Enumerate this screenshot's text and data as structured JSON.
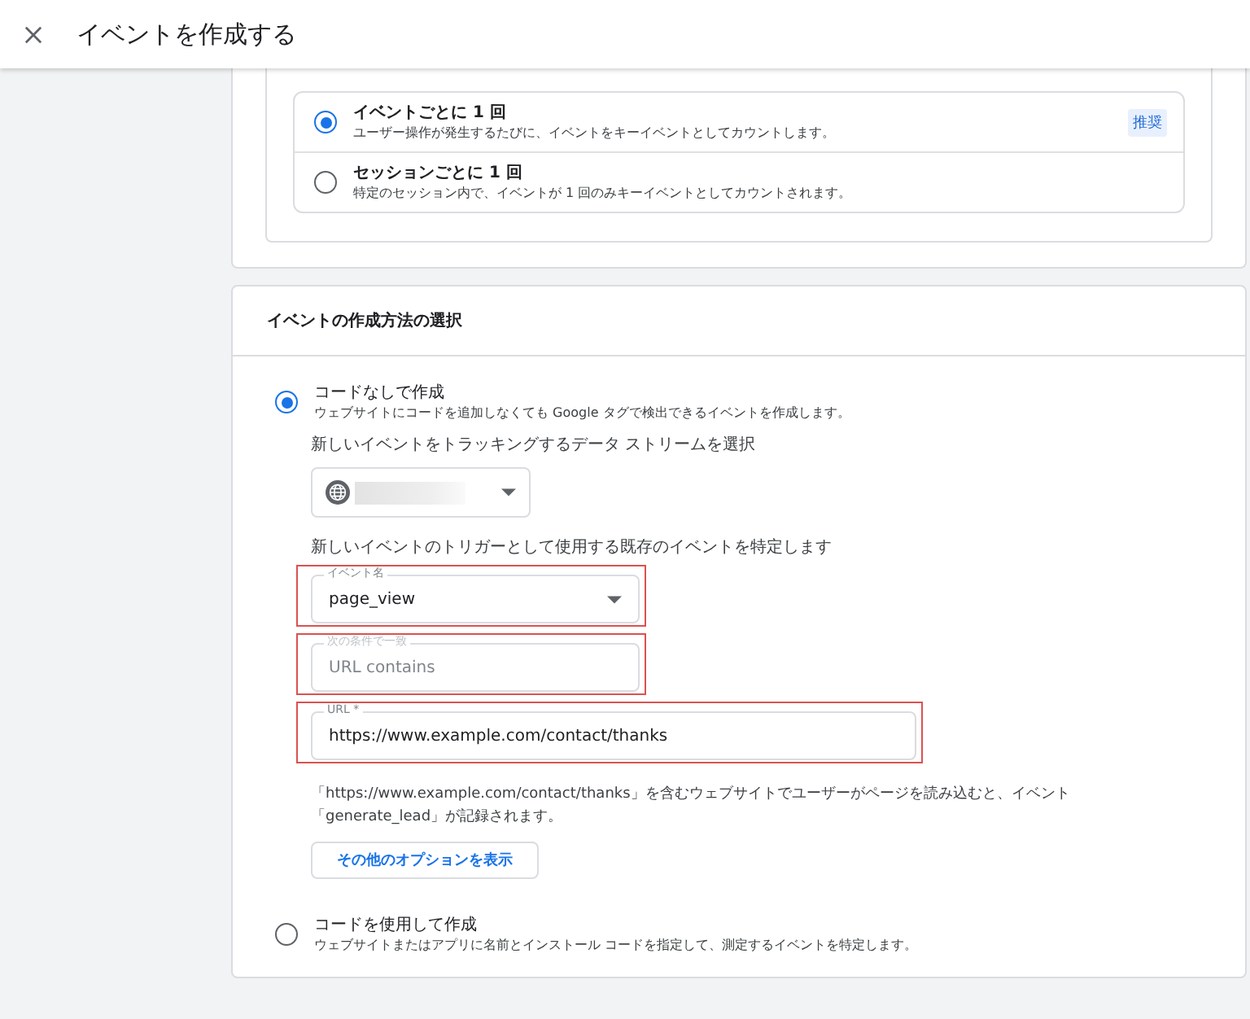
{
  "header": {
    "title": "イベントを作成する"
  },
  "count_method": {
    "options": [
      {
        "title": "イベントごとに 1 回",
        "description": "ユーザー操作が発生するたびに、イベントをキーイベントとしてカウントします。",
        "badge": "推奨",
        "selected": true
      },
      {
        "title": "セッションごとに 1 回",
        "description": "特定のセッション内で、イベントが 1 回のみキーイベントとしてカウントされます。",
        "selected": false
      }
    ]
  },
  "creation": {
    "heading": "イベントの作成方法の選択",
    "options": [
      {
        "kind": "no_code",
        "title": "コードなしで作成",
        "description": "ウェブサイトにコードを追加しなくても Google タグで検出できるイベントを作成します。",
        "selected": true
      },
      {
        "kind": "code",
        "title": "コードを使用して作成",
        "description": "ウェブサイトまたはアプリに名前とインストール コードを指定して、測定するイベントを特定します。",
        "selected": false
      }
    ],
    "stream_label": "新しいイベントをトラッキングするデータ ストリームを選択",
    "trigger_label": "新しいイベントのトリガーとして使用する既存のイベントを特定します",
    "fields": [
      {
        "kind": "select",
        "label": "イベント名",
        "value": "page_view",
        "disabled": false,
        "highlighted": true
      },
      {
        "kind": "text",
        "label": "次の条件で一致",
        "value": "URL contains",
        "disabled": true,
        "highlighted": true
      },
      {
        "kind": "text",
        "label": "URL *",
        "value": "https://www.example.com/contact/thanks",
        "disabled": false,
        "highlighted": true
      }
    ],
    "note": "「https://www.example.com/contact/thanks」を含むウェブサイトでユーザーがページを読み込むと、イベント「generate_lead」が記録されます。",
    "more_button": "その他のオプションを表示"
  }
}
